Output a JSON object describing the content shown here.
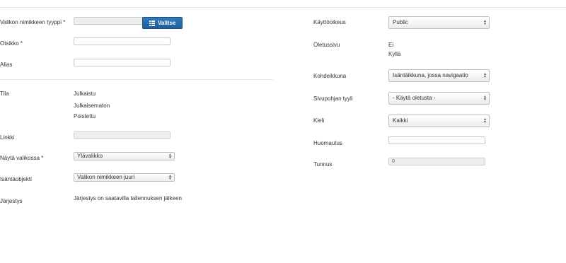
{
  "left": {
    "type_label": "Valikon nimikkeen tyyppi *",
    "select_button": "Valitse",
    "title_label": "Otsikko *",
    "alias_label": "Alias",
    "status_label": "Tila",
    "status_options": [
      "Julkaistu",
      "Julkaisematon",
      "Poistettu"
    ],
    "link_label": "Linkki",
    "menu_label": "Näytä valikossa *",
    "menu_value": "Ylävalikko",
    "parent_label": "Isäntäobjekti",
    "parent_value": "Valikon nimikkeen juuri",
    "order_label": "Järjestys",
    "order_text": "Järjestys on saatavilla tallennuksen jälkeen"
  },
  "right": {
    "access_label": "Käyttöoikeus",
    "access_value": "Public",
    "home_label": "Oletussivu",
    "home_options": [
      "Ei",
      "Kyllä"
    ],
    "target_label": "Kohdeikkuna",
    "target_value": "Isäntäikkuna, jossa navigaatio",
    "template_label": "Sivupohjan tyyli",
    "template_value": "- Käytä oletusta -",
    "language_label": "Kieli",
    "language_value": "Kaikki",
    "note_label": "Huomautus",
    "id_label": "Tunnus",
    "id_value": "0"
  },
  "icons": {
    "select_button_icon": "list-icon",
    "dropdown_icon": "updown-arrows-icon"
  },
  "colors": {
    "primary_button": "#2a6fb0"
  }
}
